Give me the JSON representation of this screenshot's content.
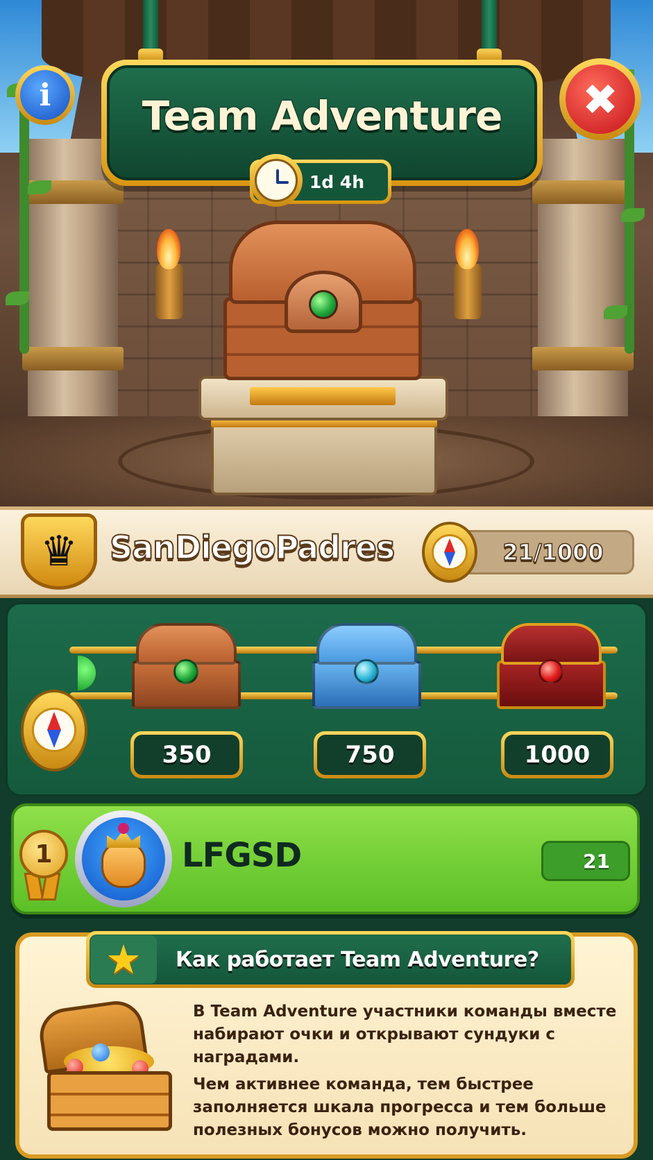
{
  "header": {
    "title": "Team Adventure",
    "timer": "1d 4h"
  },
  "team": {
    "name": "SanDiegoPadres",
    "progress": "21/1000",
    "progress_value": 21,
    "progress_max": 1000
  },
  "rewards": [
    {
      "threshold": "350",
      "chest": "copper-chest-icon",
      "color": "#c9703a"
    },
    {
      "threshold": "750",
      "chest": "blue-chest-icon",
      "color": "#4a9ae0"
    },
    {
      "threshold": "1000",
      "chest": "ruby-gold-chest-icon",
      "color": "#8a1a1a"
    }
  ],
  "leaderboard": [
    {
      "rank": "1",
      "name": "LFGSD",
      "score": "21"
    }
  ],
  "how_it_works": {
    "title": "Как работает Team Adventure?",
    "paragraphs": [
      "В Team Adventure участники команды вместе набирают очки и открывают сундуки с наградами.",
      "Чем активнее команда, тем быстрее заполняется шкала прогресса и тем больше полезных бонусов можно получить."
    ]
  },
  "icons": {
    "info": "i",
    "close": "✖",
    "crown": "♛",
    "star": "★"
  },
  "colors": {
    "panel_green": "#155a3c",
    "gold": "#d99511",
    "player_row_green": "#6ccb30",
    "close_red": "#c4121a",
    "info_blue": "#1550c2"
  }
}
